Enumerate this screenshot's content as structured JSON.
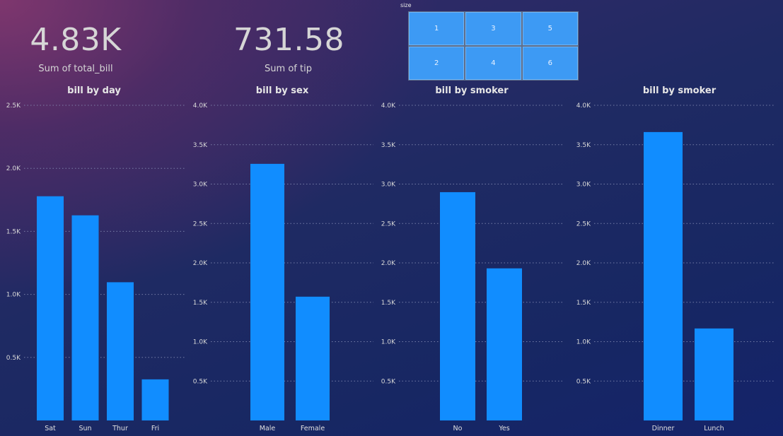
{
  "cards": [
    {
      "value": "4.83K",
      "label": "Sum of total_bill"
    },
    {
      "value": "731.58",
      "label": "Sum of tip"
    }
  ],
  "slicer": {
    "title": "size",
    "options": [
      "1",
      "3",
      "5",
      "2",
      "4",
      "6"
    ]
  },
  "colors": {
    "bar": "#118dff",
    "tile": "#3d9af4"
  },
  "chart_data": [
    {
      "type": "bar",
      "title": "bill by day",
      "categories": [
        "Sat",
        "Sun",
        "Thur",
        "Fri"
      ],
      "values": [
        1778.4,
        1627.16,
        1096.33,
        325.88
      ],
      "ylim": [
        0,
        2500
      ],
      "yticks": [
        0,
        500,
        1000,
        1500,
        2000,
        2500
      ],
      "ytick_labels": [
        "",
        "0.5K",
        "1.0K",
        "1.5K",
        "2.0K",
        "2.5K"
      ],
      "grid": true
    },
    {
      "type": "bar",
      "title": "bill by sex",
      "categories": [
        "Male",
        "Female"
      ],
      "values": [
        3256.82,
        1570.95
      ],
      "ylim": [
        0,
        4000
      ],
      "yticks": [
        0,
        500,
        1000,
        1500,
        2000,
        2500,
        3000,
        3500,
        4000
      ],
      "ytick_labels": [
        "",
        "0.5K",
        "1.0K",
        "1.5K",
        "2.0K",
        "2.5K",
        "3.0K",
        "3.5K",
        "4.0K"
      ],
      "grid": true
    },
    {
      "type": "bar",
      "title": "bill by smoker",
      "categories": [
        "No",
        "Yes"
      ],
      "values": [
        2897.43,
        1930.34
      ],
      "ylim": [
        0,
        4000
      ],
      "yticks": [
        0,
        500,
        1000,
        1500,
        2000,
        2500,
        3000,
        3500,
        4000
      ],
      "ytick_labels": [
        "",
        "0.5K",
        "1.0K",
        "1.5K",
        "2.0K",
        "2.5K",
        "3.0K",
        "3.5K",
        "4.0K"
      ],
      "grid": true
    },
    {
      "type": "bar",
      "title": "bill by smoker",
      "categories": [
        "Dinner",
        "Lunch"
      ],
      "values": [
        3660.3,
        1167.47
      ],
      "ylim": [
        0,
        4000
      ],
      "yticks": [
        0,
        500,
        1000,
        1500,
        2000,
        2500,
        3000,
        3500,
        4000
      ],
      "ytick_labels": [
        "",
        "0.5K",
        "1.0K",
        "1.5K",
        "2.0K",
        "2.5K",
        "3.0K",
        "3.5K",
        "4.0K"
      ],
      "grid": true
    }
  ]
}
